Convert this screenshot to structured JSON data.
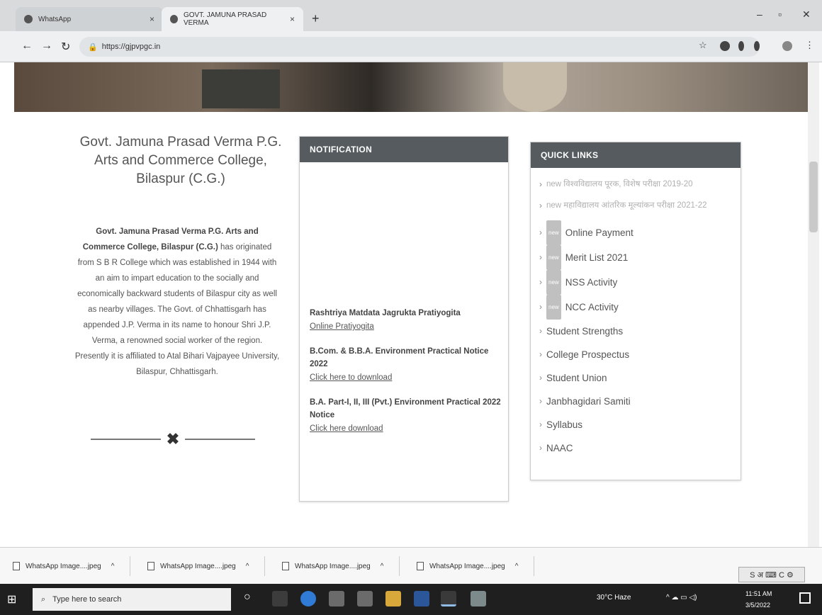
{
  "browser": {
    "tabs": [
      {
        "label": "WhatsApp",
        "active": false
      },
      {
        "label": "GOVT. JAMUNA PRASAD VERMA",
        "active": true
      }
    ],
    "url": "https://gjpvpgc.in"
  },
  "college": {
    "title": "Govt. Jamuna Prasad Verma P.G. Arts and Commerce College, Bilaspur (C.G.)",
    "about_bold": "Govt. Jamuna Prasad Verma P.G. Arts and Commerce College, Bilaspur (C.G.)",
    "about_text": "has originated from S B R College which was established in 1944 with an aim to impart education to the socially and economically backward students of Bilaspur city as well as nearby villages. The Govt. of Chhattisgarh has appended J.P. Verma in its name to honour Shri J.P. Verma, a renowned social worker of the region. Presently it is affiliated to Atal Bihari Vajpayee University, Bilaspur, Chhattisgarh."
  },
  "notification": {
    "header": "NOTIFICATION",
    "items": [
      {
        "title": "Rashtriya Matdata Jagrukta Pratiyogita",
        "link": "Online Pratiyogita"
      },
      {
        "title": "B.Com. & B.B.A. Environment Practical Notice 2022",
        "link": "Click here to download"
      },
      {
        "title": "B.A. Part-I, II, III (Pvt.) Environment Practical 2022 Notice",
        "link": "Click here download"
      }
    ]
  },
  "quick_links": {
    "header": "QUICK LINKS",
    "faint_items": [
      "new विश्वविद्यालय पूरक, विशेष परीक्षा 2019-20",
      "new महाविद्यालय आंतरिक मूल्यांकन परीक्षा 2021-22"
    ],
    "badge": "new",
    "items": [
      {
        "label": "Online Payment",
        "badge": true
      },
      {
        "label": "Merit List 2021",
        "badge": true
      },
      {
        "label": "NSS Activity",
        "badge": true
      },
      {
        "label": "NCC Activity",
        "badge": true
      },
      {
        "label": "Student Strengths",
        "badge": false
      },
      {
        "label": "College Prospectus",
        "badge": false
      },
      {
        "label": "Student Union",
        "badge": false
      },
      {
        "label": "Janbhagidari Samiti",
        "badge": false
      },
      {
        "label": "Syllabus",
        "badge": false
      },
      {
        "label": "NAAC",
        "badge": false
      }
    ]
  },
  "downloads": {
    "items": [
      "WhatsApp Image....jpeg",
      "WhatsApp Image....jpeg",
      "WhatsApp Image....jpeg",
      "WhatsApp Image....jpeg"
    ]
  },
  "taskbar": {
    "search_placeholder": "Type here to search",
    "weather": "30°C Haze",
    "time": "11:51 AM",
    "date": "3/5/2022"
  }
}
